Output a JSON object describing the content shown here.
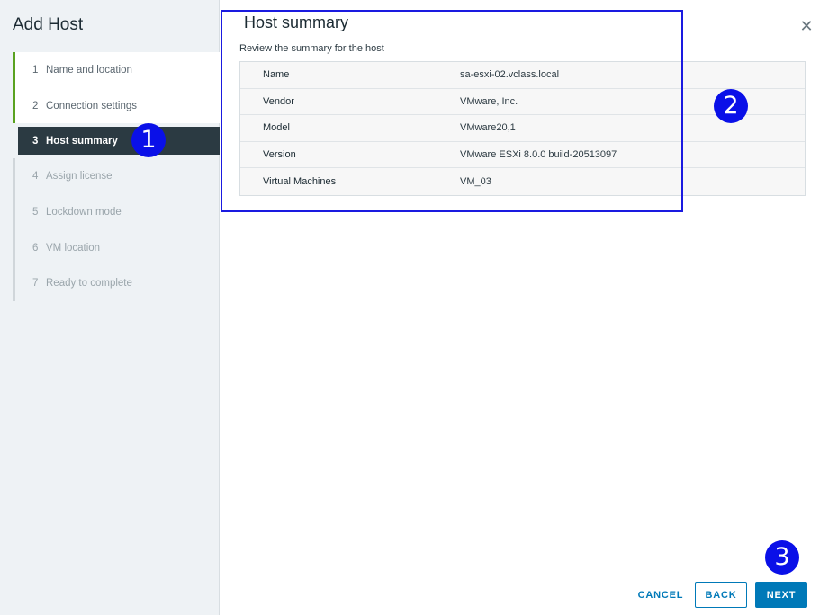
{
  "dialog": {
    "title": "Add Host",
    "close_icon": "close-icon"
  },
  "steps": [
    {
      "num": "1",
      "label": "Name and location",
      "state": "done"
    },
    {
      "num": "2",
      "label": "Connection settings",
      "state": "done"
    },
    {
      "num": "3",
      "label": "Host summary",
      "state": "active"
    },
    {
      "num": "4",
      "label": "Assign license",
      "state": "pending"
    },
    {
      "num": "5",
      "label": "Lockdown mode",
      "state": "pending"
    },
    {
      "num": "6",
      "label": "VM location",
      "state": "pending"
    },
    {
      "num": "7",
      "label": "Ready to complete",
      "state": "pending"
    }
  ],
  "main": {
    "title": "Host summary",
    "subtitle": "Review the summary for the host",
    "rows": [
      {
        "key": "Name",
        "value": "sa-esxi-02.vclass.local"
      },
      {
        "key": "Vendor",
        "value": "VMware, Inc."
      },
      {
        "key": "Model",
        "value": "VMware20,1"
      },
      {
        "key": "Version",
        "value": "VMware ESXi 8.0.0 build-20513097"
      },
      {
        "key": "Virtual Machines",
        "value": "VM_03"
      }
    ]
  },
  "markers": [
    "1",
    "2",
    "3"
  ],
  "footer": {
    "cancel_label": "CANCEL",
    "back_label": "BACK",
    "next_label": "NEXT"
  },
  "colors": {
    "accent": "#0079b8",
    "active_step": "#2b3a42",
    "done_step": "#5aa220",
    "annotation": "#0a10e8"
  }
}
